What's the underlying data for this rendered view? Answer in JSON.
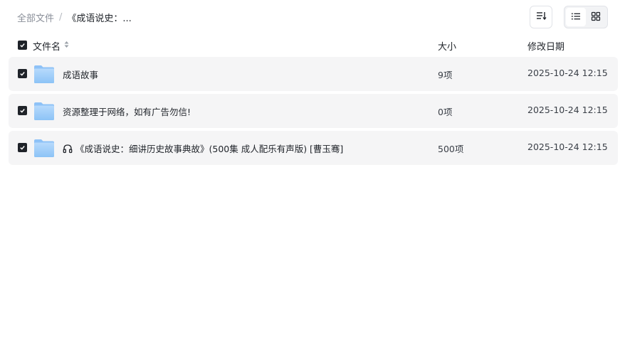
{
  "breadcrumb": {
    "root": "全部文件",
    "separator": "/",
    "current": "《成语说史：..."
  },
  "toolbar": {
    "sort_icon": "sort-icon",
    "list_view_icon": "list-view-icon",
    "grid_view_icon": "grid-view-icon",
    "active_view": "list"
  },
  "table": {
    "headers": {
      "name": "文件名",
      "size": "大小",
      "modified": "修改日期"
    },
    "rows": [
      {
        "name": "成语故事",
        "size": "9项",
        "modified": "2025-10-24 12:15",
        "icon": "folder-icon",
        "checked": true
      },
      {
        "name": "资源整理于网络，如有广告勿信!",
        "size": "0项",
        "modified": "2025-10-24 12:15",
        "icon": "folder-icon",
        "checked": true
      },
      {
        "name": "《成语说史：细讲历史故事典故》(500集 成人配乐有声版) [曹玉骞]",
        "size": "500项",
        "modified": "2025-10-24 12:15",
        "icon": "folder-icon",
        "prefix_icon": "headphones-icon",
        "checked": true
      }
    ]
  },
  "colors": {
    "row_bg": "#f5f5f6",
    "checkbox": "#1f2329",
    "folder": "#7fb8f5",
    "muted_text": "#8a8f99"
  }
}
